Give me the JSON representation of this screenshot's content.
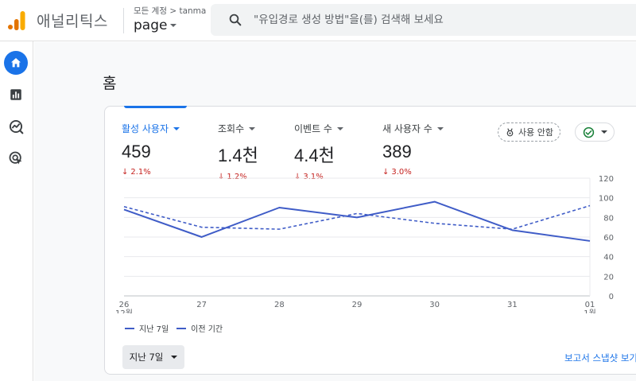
{
  "header": {
    "app_title": "애널리틱스",
    "account_crumb": "모든 계정 > tanma",
    "property_name": "page",
    "search_placeholder": "\"유입경로 생성 방법\"을(를) 검색해 보세요"
  },
  "nav": {
    "items": [
      "home-icon",
      "reports-icon",
      "explore-icon",
      "advertising-icon"
    ],
    "active": "home-icon"
  },
  "main": {
    "page_title": "홈"
  },
  "card": {
    "metrics": [
      {
        "label": "활성 사용자",
        "value": "459",
        "delta": "2.1%",
        "direction": "down"
      },
      {
        "label": "조회수",
        "value": "1.4천",
        "delta": "1.2%",
        "direction": "down"
      },
      {
        "label": "이벤트 수",
        "value": "4.4천",
        "delta": "3.1%",
        "direction": "down"
      },
      {
        "label": "새 사용자 수",
        "value": "389",
        "delta": "3.0%",
        "direction": "down"
      }
    ],
    "insight_chip_label": "사용 안함",
    "legend": {
      "current": "지난 7일",
      "previous": "이전 기간"
    },
    "range_label": "지난 7일",
    "snapshot_link": "보고서 스냅샷 보기",
    "colors": {
      "accent": "#1a73e8",
      "series": "#3f5cc7",
      "negative": "#c5221f",
      "positive": "#188038"
    }
  },
  "chart_data": {
    "type": "line",
    "x_ticks": [
      {
        "day": "26",
        "month": "12월"
      },
      {
        "day": "27",
        "month": ""
      },
      {
        "day": "28",
        "month": ""
      },
      {
        "day": "29",
        "month": ""
      },
      {
        "day": "30",
        "month": ""
      },
      {
        "day": "31",
        "month": ""
      },
      {
        "day": "01",
        "month": "1월"
      }
    ],
    "series": [
      {
        "name": "지난 7일",
        "style": "solid",
        "values": [
          88,
          60,
          90,
          80,
          96,
          67,
          56
        ]
      },
      {
        "name": "이전 기간",
        "style": "dashed",
        "values": [
          91,
          70,
          68,
          84,
          74,
          68,
          92
        ]
      }
    ],
    "y_ticks": [
      0,
      20,
      40,
      60,
      80,
      100,
      120
    ],
    "ylim": [
      0,
      120
    ],
    "grid": true
  }
}
